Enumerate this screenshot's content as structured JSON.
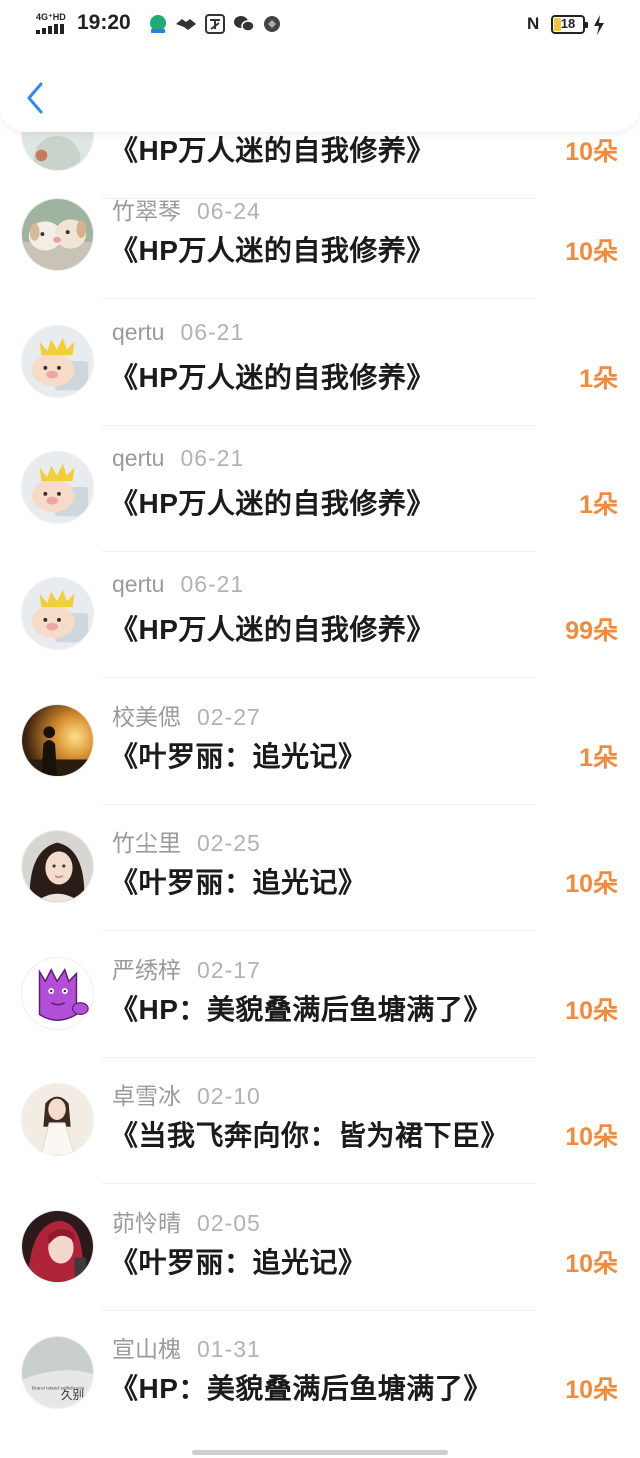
{
  "status_bar": {
    "network": "4G⁺HD",
    "time": "19:20",
    "battery": "18",
    "nfc": "N"
  },
  "header": {
    "back_icon": "chevron-left-icon"
  },
  "colors": {
    "accent": "#f28a3c",
    "username": "#9a9a9a",
    "back": "#2a8cf5"
  },
  "entries": [
    {
      "name": "",
      "date": "",
      "book": "《HP万人迷的自我修养》",
      "amount": "10朵",
      "avatar": "partial"
    },
    {
      "name": "竹翠琴",
      "date": "06-24",
      "book": "《HP万人迷的自我修养》",
      "amount": "10朵",
      "avatar": "puppies"
    },
    {
      "name": "qertu",
      "date": "06-21",
      "book": "《HP万人迷的自我修养》",
      "amount": "1朵",
      "avatar": "pig"
    },
    {
      "name": "qertu",
      "date": "06-21",
      "book": "《HP万人迷的自我修养》",
      "amount": "1朵",
      "avatar": "pig"
    },
    {
      "name": "qertu",
      "date": "06-21",
      "book": "《HP万人迷的自我修养》",
      "amount": "99朵",
      "avatar": "pig"
    },
    {
      "name": "校美偲",
      "date": "02-27",
      "book": "《叶罗丽：追光记》",
      "amount": "1朵",
      "avatar": "sunset"
    },
    {
      "name": "竹尘里",
      "date": "02-25",
      "book": "《叶罗丽：追光记》",
      "amount": "10朵",
      "avatar": "girl"
    },
    {
      "name": "严绣梓",
      "date": "02-17",
      "book": "《HP：美貌叠满后鱼塘满了》",
      "amount": "10朵",
      "avatar": "purple-cartoon"
    },
    {
      "name": "卓雪冰",
      "date": "02-10",
      "book": "《当我飞奔向你：皆为裙下臣》",
      "amount": "10朵",
      "avatar": "white-dress"
    },
    {
      "name": "茆怜晴",
      "date": "02-05",
      "book": "《叶罗丽：追光记》",
      "amount": "10朵",
      "avatar": "red-hair"
    },
    {
      "name": "宣山槐",
      "date": "01-31",
      "book": "《HP：美貌叠满后鱼塘满了》",
      "amount": "10朵",
      "avatar": "text-art",
      "avatar_text": "久别",
      "avatar_subtext": "Brand Island selfishness"
    }
  ]
}
